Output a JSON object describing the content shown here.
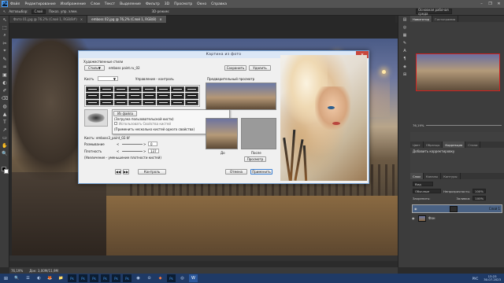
{
  "menubar": {
    "logo": "Ps",
    "items": [
      "Файл",
      "Редактирование",
      "Изображение",
      "Слои",
      "Текст",
      "Выделение",
      "Фильтр",
      "3D",
      "Просмотр",
      "Окно",
      "Справка"
    ],
    "window_controls": [
      "–",
      "❐",
      "✕"
    ]
  },
  "optbar": {
    "tool_icon": "↖",
    "auto_select_label": "Автовыбор:",
    "auto_select_value": "Слой",
    "show_controls": "Показ. упр. элем.",
    "mode_3d": "3D-режим:",
    "workspace": "Основная рабочая среда"
  },
  "tabs": [
    {
      "label": "Фото 01.jpg @ 76.2% (Слой 1, RGB/8#)",
      "close": "×"
    },
    {
      "label": "emboss 02.jpg @ 76,2% (Слой 1, RGB/8)",
      "close": "×"
    }
  ],
  "tools": [
    "↖",
    "⬚",
    "⌕",
    "✂",
    "⌖",
    "✎",
    "♒",
    "▣",
    "◐",
    "✐",
    "⌫",
    "◍",
    "▲",
    "T",
    "↗",
    "▭",
    "✋",
    "🔍"
  ],
  "status": {
    "zoom": "76,19%",
    "doc": "Док: 3,00М/11,9М"
  },
  "dock_icons": [
    "▤",
    "◎",
    "▦",
    "✎",
    "A",
    "¶",
    "◈",
    "⊞"
  ],
  "panels": {
    "top_tabs": [
      "Навигатор",
      "Гистограмма"
    ],
    "zoom": "76,19%",
    "adjust_tabs": [
      "Цвет",
      "Образцы",
      "Коррекция",
      "Стили"
    ],
    "adjust_title": "Добавить корректировку",
    "layers_tabs": [
      "Слои",
      "Каналы",
      "Контуры"
    ],
    "kind_label": "Вид",
    "blend_mode": "Обычные",
    "opacity_label": "Непрозрачность:",
    "opacity": "100%",
    "lock_label": "Закрепить:",
    "fill_label": "Заливка:",
    "fill": "100%",
    "layers": [
      {
        "name": "Слой 1",
        "selected": true
      },
      {
        "name": "Фон",
        "selected": false
      }
    ]
  },
  "dialog": {
    "title": "Картина из фото",
    "art_styles_label": "Художественные стили",
    "style_select": "Стиль",
    "style_name": "emboss paint.ru_02",
    "save_btn": "Сохранить",
    "delete_btn": "Удалить",
    "brush_label": "Кисть",
    "control_label": "Управление - контроль",
    "preview_label": "Предварительный просмотр",
    "from_file": "Из файла",
    "load_custom": "(Загрузка пользовательской кисти)",
    "use_props": "Использовать Свойства кистей",
    "apply_multi": "(Применить несколько кистей одного свойства)",
    "brush_name": "Кисть: emboss3_paint_02.tif",
    "blur_label": "Размывание",
    "blur_value": "0",
    "density_label": "Плотность",
    "density_value": "137",
    "density_hint": "(Увеличение - уменьшение плотности кистей)",
    "before_label": "До",
    "after_label": "После",
    "preview_btn": "Просмотр",
    "nav_prev": "◀◀",
    "nav_next": "▶▶",
    "control_btn": "Контроль",
    "cancel_btn": "Отмена",
    "apply_btn": "Применить"
  },
  "taskbar": {
    "icons": [
      "⊞",
      "🔍",
      "☰",
      "◐",
      "🦊",
      "📁",
      "Ps",
      "Ps",
      "Ps",
      "Ps",
      "Ps",
      "Ps",
      "◉",
      "⊙",
      "◆",
      "Ps",
      "◎",
      "W"
    ],
    "clock_time": "13:23",
    "clock_date": "30.07.2023",
    "tray": "РУС"
  }
}
